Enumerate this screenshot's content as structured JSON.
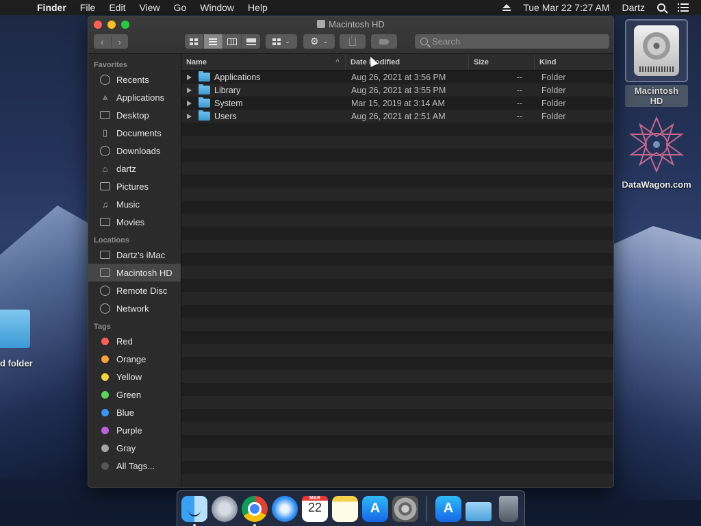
{
  "menubar": {
    "items": [
      "Finder",
      "File",
      "Edit",
      "View",
      "Go",
      "Window",
      "Help"
    ],
    "clock": "Tue Mar 22  7:27 AM",
    "user": "Dartz"
  },
  "window": {
    "title": "Macintosh HD",
    "search_placeholder": "Search"
  },
  "sidebar": {
    "favorites_heading": "Favorites",
    "favorites": [
      "Recents",
      "Applications",
      "Desktop",
      "Documents",
      "Downloads",
      "dartz",
      "Pictures",
      "Music",
      "Movies"
    ],
    "locations_heading": "Locations",
    "locations": [
      "Dartz's iMac",
      "Macintosh HD",
      "Remote Disc",
      "Network"
    ],
    "tags_heading": "Tags",
    "tags": [
      {
        "label": "Red",
        "color": "#fe5f57"
      },
      {
        "label": "Orange",
        "color": "#f5a33a"
      },
      {
        "label": "Yellow",
        "color": "#f4d33f"
      },
      {
        "label": "Green",
        "color": "#5dd35a"
      },
      {
        "label": "Blue",
        "color": "#3b94f6"
      },
      {
        "label": "Purple",
        "color": "#bb62db"
      },
      {
        "label": "Gray",
        "color": "#a5a5a5"
      },
      {
        "label": "All Tags...",
        "color": "#555555"
      }
    ]
  },
  "columns": {
    "name": "Name",
    "date": "Date Modified",
    "size": "Size",
    "kind": "Kind"
  },
  "rows": [
    {
      "name": "Applications",
      "date": "Aug 26, 2021 at 3:56 PM",
      "size": "--",
      "kind": "Folder"
    },
    {
      "name": "Library",
      "date": "Aug 26, 2021 at 3:55 PM",
      "size": "--",
      "kind": "Folder"
    },
    {
      "name": "System",
      "date": "Mar 15, 2019 at 3:14 AM",
      "size": "--",
      "kind": "Folder"
    },
    {
      "name": "Users",
      "date": "Aug 26, 2021 at 2:51 AM",
      "size": "--",
      "kind": "Folder"
    }
  ],
  "desktop": {
    "hd_label": "Macintosh HD",
    "datawagon_label": "DataWagon.com",
    "folder_label": "d folder"
  },
  "dock": {
    "calendar_month": "MAR",
    "calendar_day": "22"
  }
}
